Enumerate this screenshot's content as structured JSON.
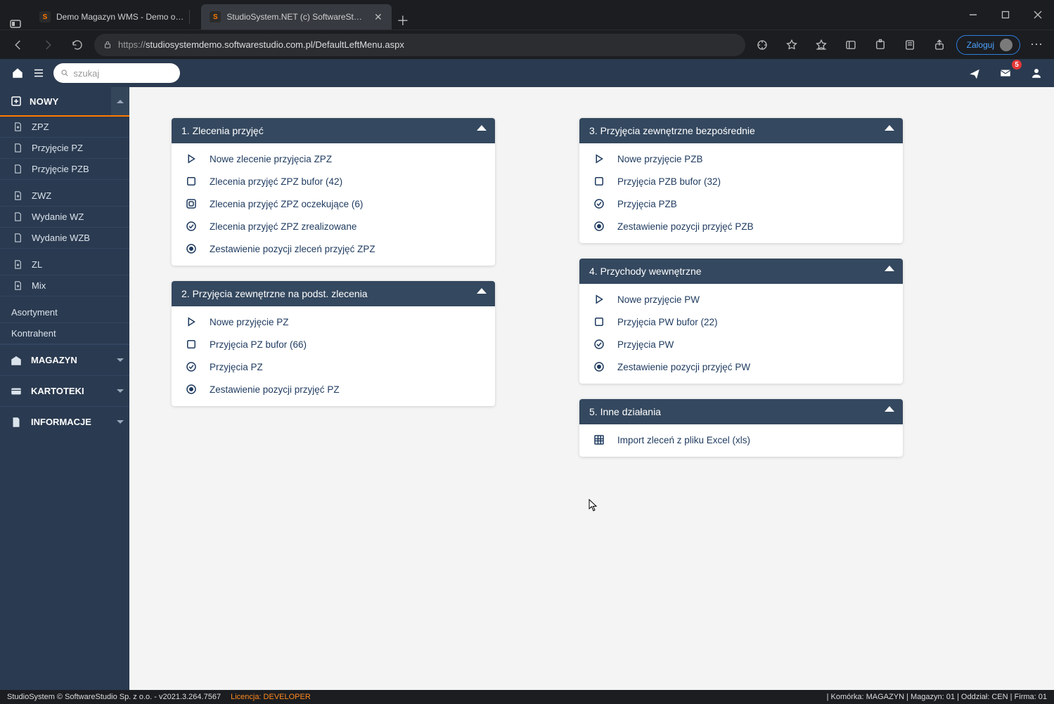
{
  "browser": {
    "tab1": "Demo Magazyn WMS - Demo o…",
    "tab2": "StudioSystem.NET (c) SoftwareSt…",
    "url_proto": "https://",
    "url_rest": "studiosystemdemo.softwarestudio.com.pl/DefaultLeftMenu.aspx",
    "login": "Zaloguj"
  },
  "header": {
    "search_placeholder": "szukaj",
    "mail_badge": "5"
  },
  "sidebar": {
    "nowy": "NOWY",
    "items1": [
      "ZPZ",
      "Przyjęcie PZ",
      "Przyjęcie PZB"
    ],
    "items2": [
      "ZWZ",
      "Wydanie WZ",
      "Wydanie WZB"
    ],
    "items3": [
      "ZL",
      "Mix"
    ],
    "plain1": "Asortyment",
    "plain2": "Kontrahent",
    "sec1": "MAGAZYN",
    "sec2": "KARTOTEKI",
    "sec3": "INFORMACJE"
  },
  "panels": {
    "p1": {
      "title": "1. Zlecenia przyjęć",
      "rows": [
        "Nowe zlecenie przyjęcia ZPZ",
        "Zlecenia przyjęć ZPZ bufor (42)",
        "Zlecenia przyjęć ZPZ oczekujące (6)",
        "Zlecenia przyjęć ZPZ zrealizowane",
        "Zestawienie pozycji zleceń przyjęć ZPZ"
      ]
    },
    "p2": {
      "title": "2. Przyjęcia zewnętrzne na podst. zlecenia",
      "rows": [
        "Nowe przyjęcie PZ",
        "Przyjęcia PZ bufor (66)",
        "Przyjęcia PZ",
        "Zestawienie pozycji przyjęć PZ"
      ]
    },
    "p3": {
      "title": "3. Przyjęcia zewnętrzne bezpośrednie",
      "rows": [
        "Nowe przyjęcie PZB",
        "Przyjęcia PZB bufor (32)",
        "Przyjęcia PZB",
        "Zestawienie pozycji przyjęć PZB"
      ]
    },
    "p4": {
      "title": "4. Przychody wewnętrzne",
      "rows": [
        "Nowe przyjęcie PW",
        "Przyjęcia PW bufor (22)",
        "Przyjęcia PW",
        "Zestawienie pozycji przyjęć PW"
      ]
    },
    "p5": {
      "title": "5. Inne działania",
      "rows": [
        "Import zleceń z pliku Excel (xls)"
      ]
    }
  },
  "footer": {
    "left": "StudioSystem © SoftwareStudio Sp. z o.o. - v2021.3.264.7567",
    "lic": "Licencja: DEVELOPER",
    "right": "| Komórka: MAGAZYN | Magazyn: 01 | Oddział: CEN | Firma: 01"
  }
}
